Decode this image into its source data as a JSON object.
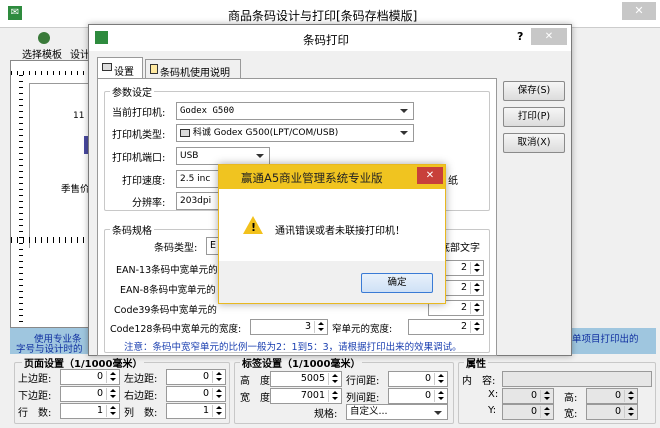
{
  "main_window": {
    "title": "商品条码设计与打印[条码存档模版]",
    "tool_select": "选择模板",
    "tool_design": "设计",
    "side_fragment_11": "11",
    "side_fragment_price": "季售价",
    "info_left": "使用专业条",
    "info_left2": "字号与设计时的",
    "info_right": "单项目打印出的"
  },
  "page_setup": {
    "title": "页面设置（1/1000毫米）",
    "top_label": "上边距:",
    "top_value": "0",
    "left_label": "左边距:",
    "left_value": "0",
    "bottom_label": "下边距:",
    "bottom_value": "0",
    "right_label": "右边距:",
    "right_value": "0",
    "rows_label": "行　数:",
    "rows_value": "1",
    "cols_label": "列　数:",
    "cols_value": "1"
  },
  "label_setup": {
    "title": "标签设置（1/1000毫米）",
    "height_label": "高　度:",
    "height_value": "5005",
    "rowgap_label": "行间距:",
    "rowgap_value": "0",
    "width_label": "宽　度:",
    "width_value": "7001",
    "colgap_label": "列间距:",
    "colgap_value": "0",
    "spec_label": "规格:",
    "spec_value": "自定义..."
  },
  "misc_box": {
    "title": "属性",
    "content_label": "内　容:",
    "x_label": "X:",
    "x_value": "0",
    "h_label": "高:",
    "h_value": "0",
    "y_label": "Y:",
    "y_value": "0",
    "w_label": "宽:",
    "w_value": "0"
  },
  "barcode_dialog": {
    "title": "条码打印",
    "help": "?",
    "close": "✕",
    "tab_settings": "设置",
    "tab_manual": "条码机使用说明",
    "params_group": "参数设定",
    "printer_label": "当前打印机:",
    "printer_value": "Godex G500",
    "ptype_label": "打印机类型:",
    "ptype_value": "科诚 Godex G500(LPT/COM/USB)",
    "port_label": "打印机端口:",
    "port_value": "USB",
    "speed_label": "打印速度:",
    "speed_value": "2.5 inc",
    "dpi_label": "分辨率:",
    "dpi_value": "203dpi",
    "paper_fragment": "纸",
    "spec_group": "条码规格",
    "bctype_label": "条码类型:",
    "bctype_value": "E",
    "bottom_text_fragment": "底部文字",
    "ean13_label": "EAN-13条码中宽单元的",
    "ean13_value": "2",
    "ean8_label": "EAN-8条码中宽单元的",
    "ean8_value": "2",
    "code39_label": "Code39条码中宽单元的",
    "code39_value": "2",
    "code128_label": "Code128条码中宽单元的宽度:",
    "code128_value": "3",
    "narrow_label": "窄单元的宽度:",
    "narrow_value": "2",
    "note": "注意：条码中宽窄单元的比例一般为2：1到5：3，请根据打印出来的效果调试。",
    "save_btn": "保存(S)",
    "print_btn": "打印(P)",
    "cancel_btn": "取消(X)"
  },
  "alert": {
    "title": "赢通A5商业管理系统专业版",
    "close": "✕",
    "message": "通讯错误或者未联接打印机！",
    "ok": "确定"
  }
}
